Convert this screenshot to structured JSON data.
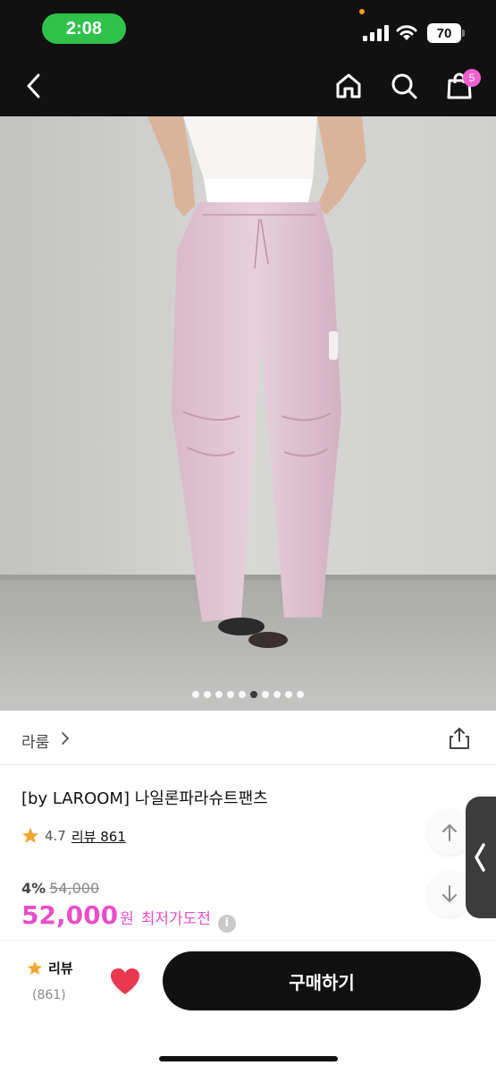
{
  "status_bar": {
    "time": "2:08",
    "battery": "70"
  },
  "nav": {
    "cart_count": "5"
  },
  "image_pager": {
    "count": 10,
    "active_index": 5
  },
  "brand": {
    "name": "라룸"
  },
  "product": {
    "title": "[by LAROOM] 나일론파라슈트팬츠",
    "rating": "4.7",
    "review_link": "리뷰 861"
  },
  "pricing": {
    "discount_rate": "4%",
    "original_price": "54,000",
    "sale_price": "52,000",
    "currency": "원",
    "lowest_price_label": "최저가도전",
    "info_icon": "i"
  },
  "bottom_bar": {
    "review_label": "리뷰",
    "review_count": "(861)",
    "buy_label": "구매하기"
  },
  "colors": {
    "accent_pink": "#e84fc7",
    "status_green": "#2fc24b",
    "star": "#f2a531",
    "heart": "#e8384f"
  }
}
